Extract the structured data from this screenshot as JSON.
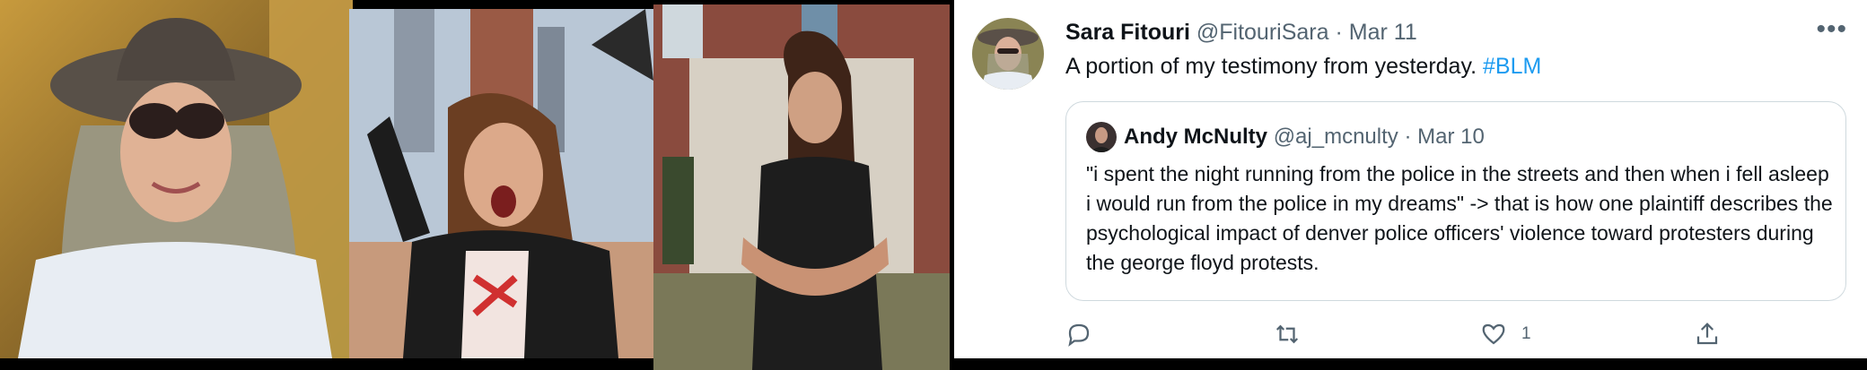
{
  "tweet": {
    "author_name": "Sara Fitouri",
    "author_handle": "@FitouriSara",
    "separator": "·",
    "date": "Mar 11",
    "text": "A portion of my testimony from yesterday.",
    "hashtag": "#BLM",
    "more_icon": "more-horizontal-icon",
    "quote": {
      "author_name": "Andy McNulty",
      "author_handle": "@aj_mcnulty",
      "separator": "·",
      "date": "Mar 10",
      "text": "\"i spent the night running from the police in the streets and then when i fell asleep i would run from the police in my dreams\" -> that is how one plaintiff describes the psychological impact of denver police officers' violence toward protesters during the george floyd protests."
    },
    "actions": {
      "reply_icon": "reply-icon",
      "retweet_icon": "retweet-icon",
      "like_icon": "heart-icon",
      "like_count": "1",
      "share_icon": "share-icon"
    }
  },
  "colors": {
    "link": "#1d9bf0",
    "text": "#0f1419",
    "muted": "#536471",
    "border": "#cfd9de"
  }
}
